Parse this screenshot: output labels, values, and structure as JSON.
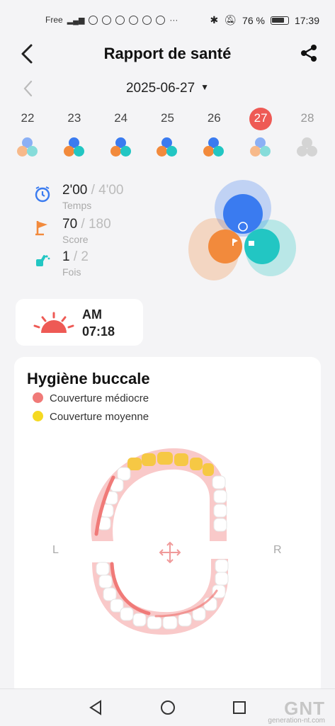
{
  "status_bar": {
    "carrier": "Free",
    "icons": [
      "signal-icon",
      "wifi-icon",
      "pinterest-icon",
      "spotify-icon",
      "sync-icon",
      "messenger-icon",
      "facebook-icon",
      "more-icon"
    ],
    "more": "···",
    "battery_percent": "76 %",
    "time": "17:39"
  },
  "header": {
    "title": "Rapport de santé"
  },
  "date": {
    "selected": "2025-06-27"
  },
  "days": [
    {
      "label": "22"
    },
    {
      "label": "23"
    },
    {
      "label": "24"
    },
    {
      "label": "25"
    },
    {
      "label": "26"
    },
    {
      "label": "27"
    },
    {
      "label": "28"
    }
  ],
  "stats": {
    "time": {
      "value": "2'00",
      "goal": "/ 4'00",
      "label": "Temps"
    },
    "score": {
      "value": "70",
      "goal": "/ 180",
      "label": "Score"
    },
    "count": {
      "value": "1",
      "goal": "/ 2",
      "label": "Fois"
    }
  },
  "session": {
    "period": "AM",
    "time": "07:18"
  },
  "hygiene": {
    "title": "Hygiène buccale",
    "legend": [
      {
        "label": "Couverture médiocre",
        "color": "#f07a78"
      },
      {
        "label": "Couverture moyenne",
        "color": "#f5d922"
      }
    ],
    "left_label": "L",
    "right_label": "R"
  },
  "colors": {
    "accent": "#ee5a55",
    "blue": "#3a7bf0",
    "orange": "#f28a3c",
    "teal": "#22c6c3"
  },
  "watermark": {
    "brand": "GNT",
    "site": "generation-nt.com"
  }
}
